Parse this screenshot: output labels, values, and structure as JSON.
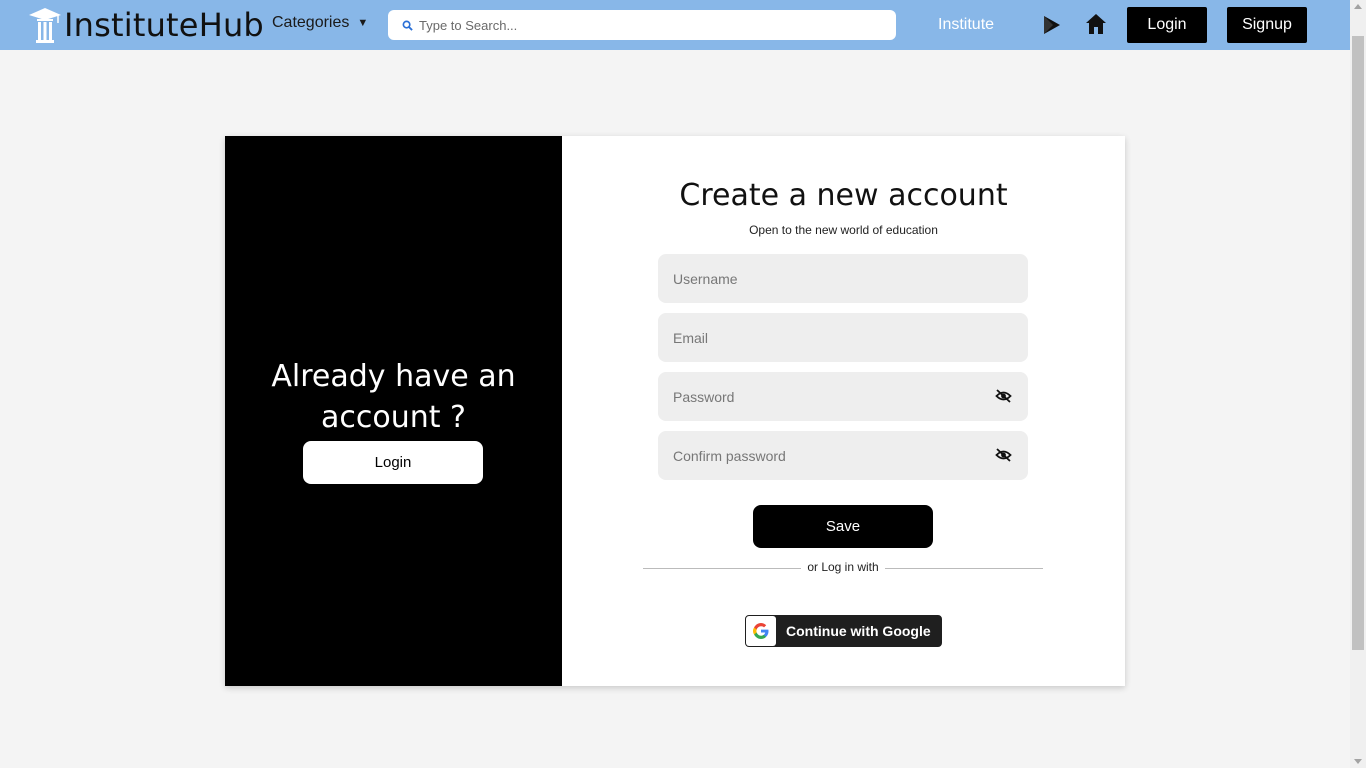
{
  "header": {
    "brand": "InstituteHub",
    "categories_label": "Categories",
    "search_placeholder": "Type to Search...",
    "institute_link": "Institute",
    "login_label": "Login",
    "signup_label": "Signup",
    "icons": [
      "graduation-pillar-logo",
      "search-icon",
      "play-store-icon",
      "home-icon"
    ],
    "bar_color": "#88b7e8"
  },
  "left_panel": {
    "heading": "Already have an account ?",
    "login_label": "Login"
  },
  "form": {
    "title": "Create a new account",
    "subtitle": "Open to the new world of education",
    "username_placeholder": "Username",
    "email_placeholder": "Email",
    "password_placeholder": "Password",
    "confirm_placeholder": "Confirm password",
    "save_label": "Save",
    "divider_text": "or Log in with",
    "google_label": "Continue with Google"
  }
}
